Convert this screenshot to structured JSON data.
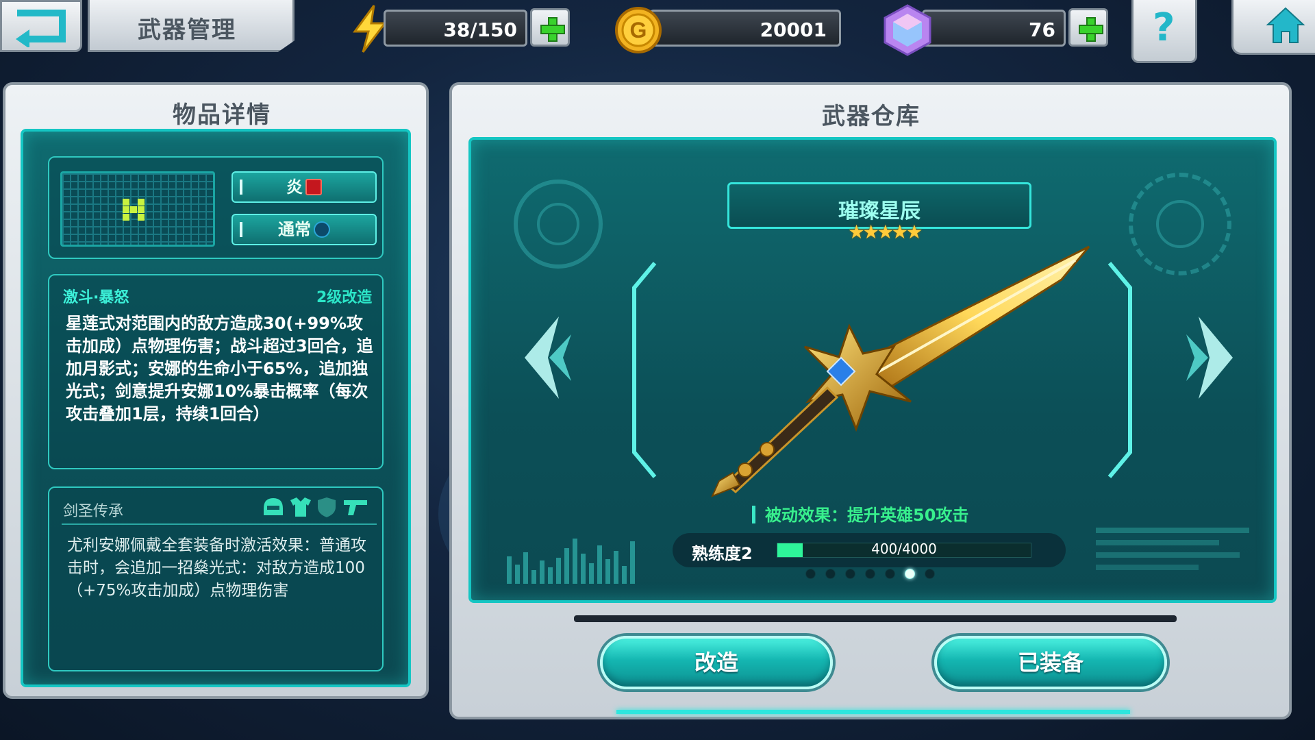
{
  "header": {
    "title": "武器管理",
    "energy": "38/150",
    "gold": "20001",
    "gems": "76",
    "help_glyph": "?",
    "icons": [
      "back-icon",
      "lightning-icon",
      "gold-coin-icon",
      "gem-icon",
      "plus-icon",
      "help-icon",
      "home-icon"
    ]
  },
  "detail_panel": {
    "title": "物品详情",
    "element_tag": "炎",
    "rarity_tag": "通常",
    "skill": {
      "name": "激斗·暴怒",
      "level": "2级改造",
      "description": "星莲式对范围内的敌方造成30(+99%攻击加成）点物理伤害；战斗超过3回合，追加月影式；安娜的生命小于65%，追加独光式；剑意提升安娜10%暴击概率（每次攻击叠加1层，持续1回合）"
    },
    "set_bonus": {
      "name": "剑圣传承",
      "description": "尤利安娜佩戴全套装备时激活效果：普通攻击时，会追加一招燊光式：对敌方造成100（+75%攻击加成）点物理伤害",
      "icons": [
        "helmet-icon",
        "armor-icon",
        "shield-icon",
        "gun-icon"
      ]
    }
  },
  "warehouse_panel": {
    "title": "武器仓库",
    "weapon_name": "璀璨星辰",
    "stars": "★★★★★",
    "star_count": 5,
    "passive_effect": "被动效果：提升英雄50攻击",
    "proficiency_label": "熟练度2",
    "proficiency_value": "400/4000",
    "proficiency_fraction": 0.1,
    "page_count": 7,
    "page_active_index": 5,
    "modify_button": "改造",
    "equipped_button": "已装备"
  },
  "colors": {
    "accent_teal": "#15c6c3",
    "skill_name": "#3cf0d8",
    "level_text": "#2ce6c8",
    "passive_green": "#38f08d",
    "star_gold": "#ffcb3a",
    "plus_green": "#39d22d"
  }
}
